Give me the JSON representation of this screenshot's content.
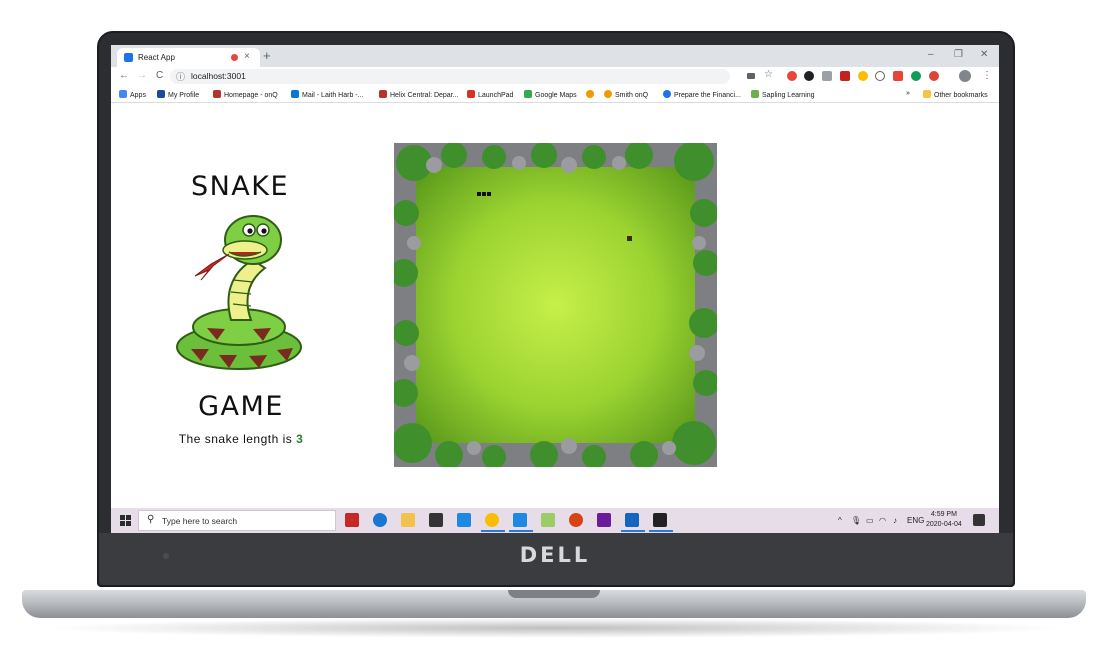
{
  "browser": {
    "tab_title": "React App",
    "new_tab_label": "+",
    "close_tab": "×",
    "url": "localhost:3001",
    "window_controls": {
      "minimize": "–",
      "maximize": "❐",
      "close": "✕"
    },
    "nav": {
      "back": "←",
      "forward": "→",
      "reload": "C"
    }
  },
  "bookmarks": {
    "items": [
      {
        "label": "Apps",
        "color": "#e8453c"
      },
      {
        "label": "My Profile",
        "color": "#1a4a9c"
      },
      {
        "label": "Homepage - onQ",
        "color": "#b5332b"
      },
      {
        "label": "Mail - Laith Harb -...",
        "color": "#0078d4"
      },
      {
        "label": "Helix Central: Depar...",
        "color": "#b5332b"
      },
      {
        "label": "LaunchPad",
        "color": "#d93025"
      },
      {
        "label": "Google Maps",
        "color": "#34a853"
      },
      {
        "label": "Smith onQ",
        "color": "#f29900"
      },
      {
        "label": "Prepare the Financi...",
        "color": "#1a73e8"
      },
      {
        "label": "Sapling Learning",
        "color": "#6ab04c"
      }
    ],
    "more": "»",
    "other": "Other bookmarks"
  },
  "game": {
    "title_top": "SNAKE",
    "title_bottom": "GAME",
    "length_label": "The snake length is",
    "length_value": "3"
  },
  "taskbar": {
    "search_placeholder": "Type here to search",
    "language": "ENG",
    "time": "4:59 PM",
    "date": "2020-04-04"
  },
  "laptop": {
    "brand": "DELL"
  }
}
